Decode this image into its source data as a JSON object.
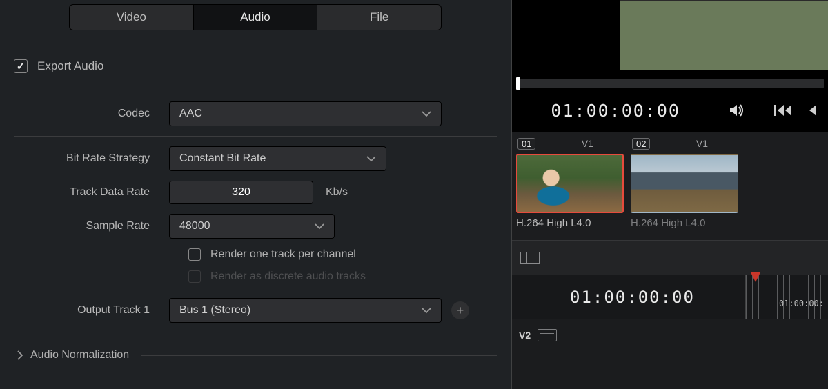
{
  "tabs": {
    "video": "Video",
    "audio": "Audio",
    "file": "File"
  },
  "export": {
    "label": "Export Audio",
    "checked": true
  },
  "codec": {
    "label": "Codec",
    "value": "AAC"
  },
  "bitRateStrategy": {
    "label": "Bit Rate Strategy",
    "value": "Constant Bit Rate"
  },
  "trackDataRate": {
    "label": "Track Data Rate",
    "value": "320",
    "unit": "Kb/s"
  },
  "sampleRate": {
    "label": "Sample Rate",
    "value": "48000"
  },
  "renderOnePerChannel": {
    "label": "Render one track per channel",
    "checked": false
  },
  "renderDiscrete": {
    "label": "Render as discrete audio tracks",
    "checked": false
  },
  "outputTrack": {
    "label": "Output Track 1",
    "value": "Bus 1 (Stereo)"
  },
  "section": {
    "audioNormalization": "Audio Normalization"
  },
  "viewer": {
    "timecode": "01:00:00:00"
  },
  "clips": [
    {
      "num": "01",
      "track": "V1",
      "label": "H.264 High L4.0",
      "selected": true
    },
    {
      "num": "02",
      "track": "V1",
      "label": "H.264 High L4.0",
      "selected": false
    }
  ],
  "timeline": {
    "timecode": "01:00:00:00",
    "rulerLabel": "01:00:00:",
    "track": "V2"
  }
}
